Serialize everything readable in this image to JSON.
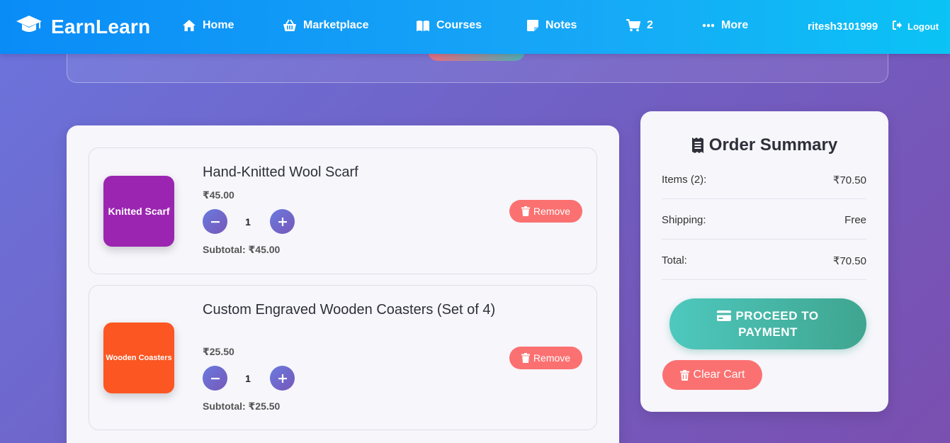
{
  "nav": {
    "brand": "EarnLearn",
    "items": [
      {
        "label": "Home",
        "icon": "home-icon"
      },
      {
        "label": "Marketplace",
        "icon": "basket-icon"
      },
      {
        "label": "Courses",
        "icon": "book-icon"
      },
      {
        "label": "Notes",
        "icon": "note-icon"
      },
      {
        "label": "2",
        "icon": "cart-icon"
      },
      {
        "label": "More",
        "icon": "dots-icon"
      }
    ],
    "user": "ritesh3101999",
    "logout": "Logout"
  },
  "cart": {
    "items": [
      {
        "thumb_text": "Knitted Scarf",
        "thumb_color": "#9b25b1",
        "title": "Hand-Knitted Wool Scarf",
        "price": "₹45.00",
        "quantity": "1",
        "subtotal": "Subtotal: ₹45.00",
        "remove": "Remove"
      },
      {
        "thumb_text": "Wooden Coasters",
        "thumb_color": "#fc5622",
        "title": "Custom Engraved Wooden Coasters (Set of 4)",
        "price": "₹25.50",
        "quantity": "1",
        "subtotal": "Subtotal: ₹25.50",
        "remove": "Remove"
      }
    ]
  },
  "summary": {
    "title": "Order Summary",
    "rows": [
      {
        "label": "Items (2):",
        "value": "₹70.50"
      },
      {
        "label": "Shipping:",
        "value": "Free"
      },
      {
        "label": "Total:",
        "value": "₹70.50"
      }
    ],
    "pay_label": "PROCEED TO PAYMENT",
    "clear_label": "Clear Cart"
  },
  "colors": {
    "nav_start": "#0a8cf7",
    "nav_end": "#0bc3f5",
    "remove": "#fb7171",
    "pay_start": "#4ec8be",
    "pay_end": "#3fa58f",
    "qty": "#6a6ad0"
  }
}
